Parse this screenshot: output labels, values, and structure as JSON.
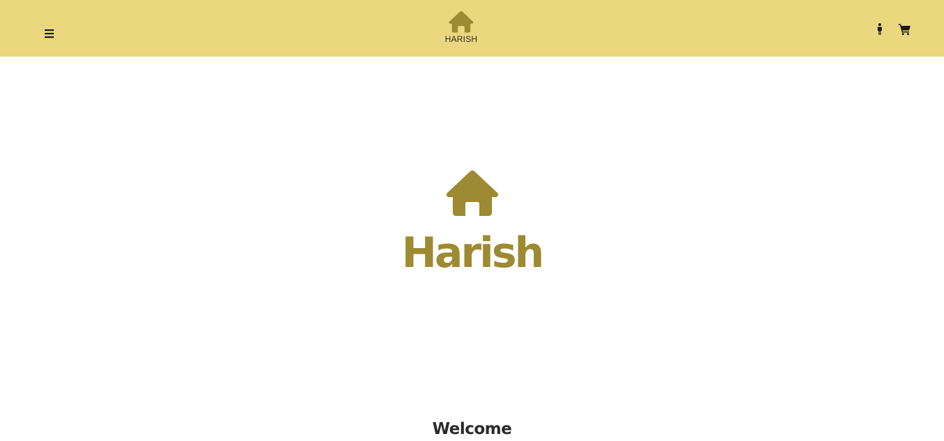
{
  "header": {
    "brand_name": "HARISH",
    "background_color": "#ebd77d",
    "menu_icon": "hamburger-menu-icon",
    "brand_icon": "home-icon",
    "right_icons": [
      "accessibility-icon",
      "shopping-cart-icon"
    ]
  },
  "hero": {
    "icon": "home-icon",
    "title": "Harish",
    "accent_color": "#9d8a32"
  },
  "welcome": {
    "heading": "Welcome"
  }
}
